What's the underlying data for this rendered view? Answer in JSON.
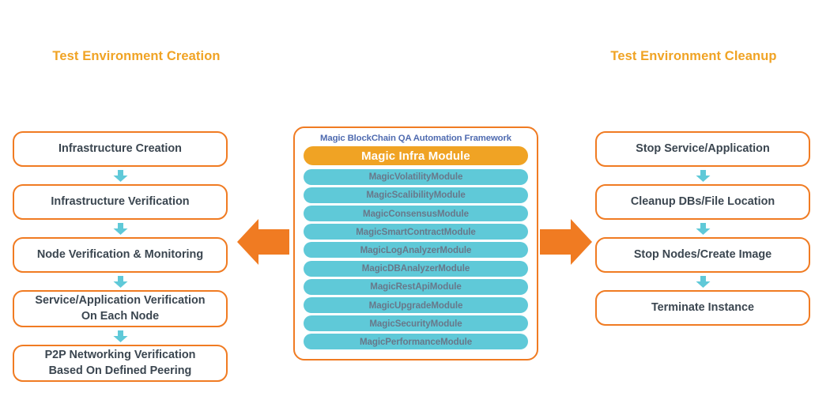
{
  "diagram": {
    "left_column": {
      "title": "Test Environment Creation",
      "steps": [
        {
          "label": "Infrastructure Creation"
        },
        {
          "label": "Infrastructure Verification"
        },
        {
          "label": "Node Verification & Monitoring"
        },
        {
          "label": "Service/Application Verification",
          "label2": "On Each Node"
        },
        {
          "label": "P2P Networking Verification",
          "label2": "Based On Defined Peering"
        }
      ]
    },
    "right_column": {
      "title": "Test Environment Cleanup",
      "steps": [
        {
          "label": "Stop Service/Application"
        },
        {
          "label": "Cleanup DBs/File Location"
        },
        {
          "label": "Stop Nodes/Create Image"
        },
        {
          "label": "Terminate Instance"
        }
      ]
    },
    "center_panel": {
      "title": "Magic BlockChain QA Automation Framework",
      "primary_module": "Magic Infra Module",
      "modules": [
        "MagicVolatilityModule",
        "MagicScalibilityModule",
        "MagicConsensusModule",
        "MagicSmartContractModule",
        "MagicLogAnalyzerModule",
        "MagicDBAnalyzerModule",
        "MagicRestApiModule",
        "MagicUpgradeModule",
        "MagicSecurityModule",
        "MagicPerformanceModule"
      ]
    },
    "arrows": {
      "left_arrow": "arrow-left-icon",
      "right_arrow": "arrow-right-icon",
      "connector": "arrow-down-icon"
    },
    "colors": {
      "orange_border": "#F07B22",
      "orange_accent": "#F0A324",
      "teal": "#5FC9D8",
      "panel_title": "#4F6BB0",
      "box_text": "#3B4650",
      "module_text": "#68788A",
      "background": "#FFFFFF"
    }
  }
}
